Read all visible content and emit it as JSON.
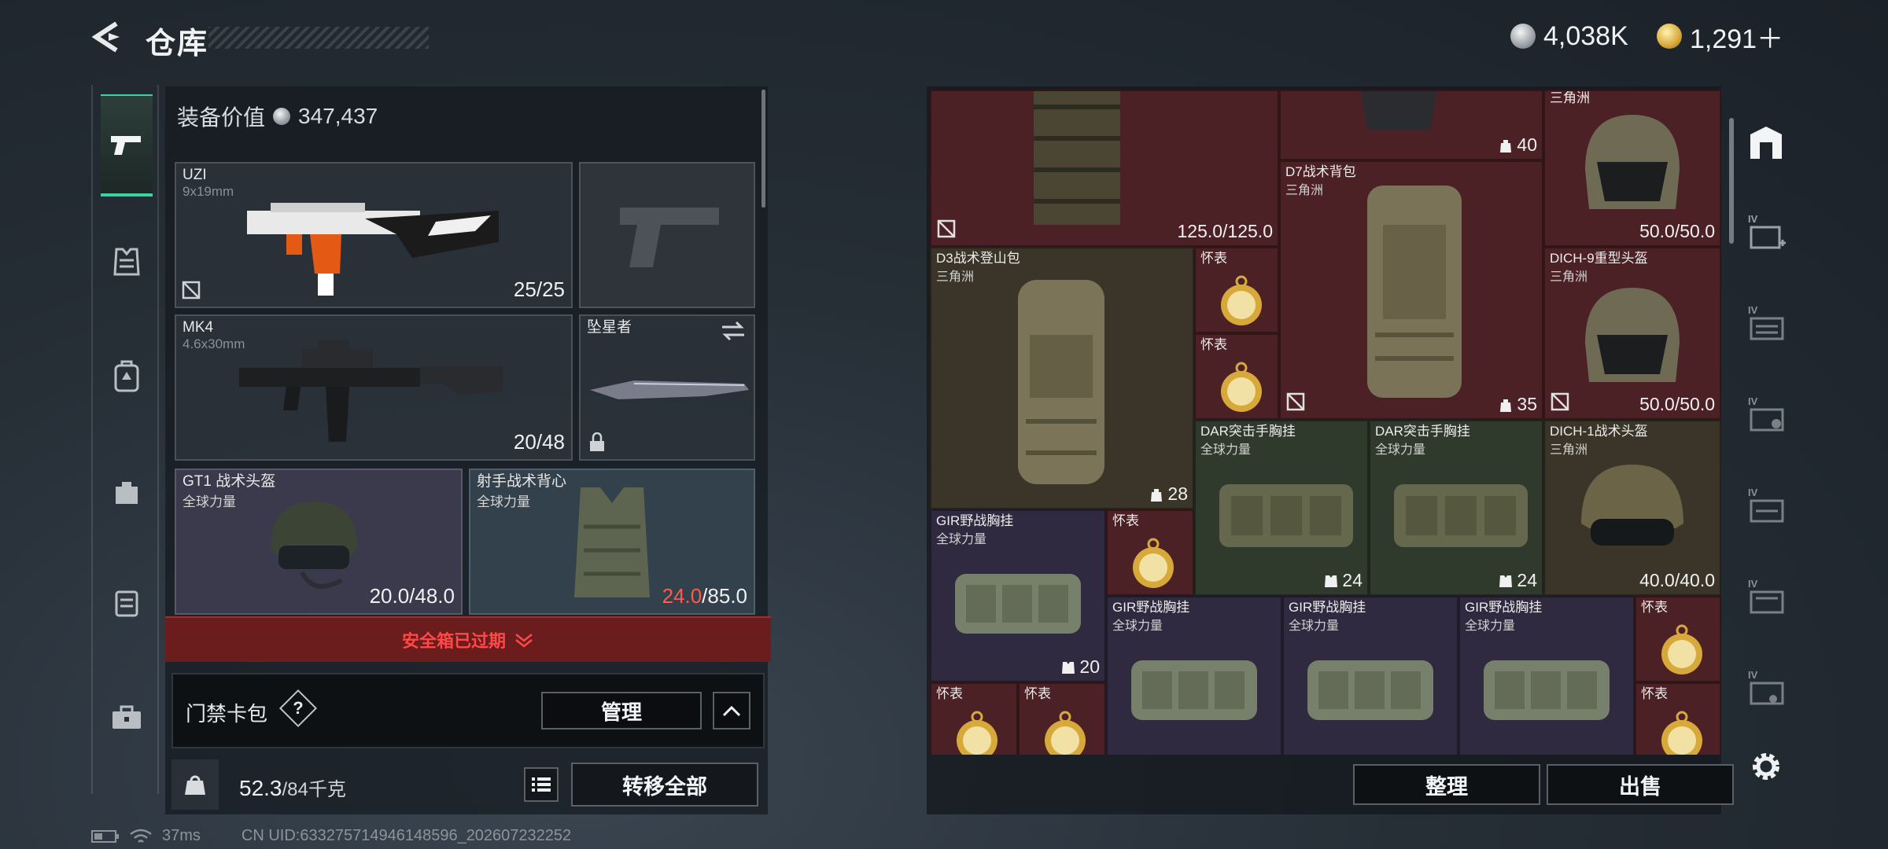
{
  "header": {
    "title": "仓库",
    "currencies": [
      {
        "name": "silver-coin",
        "amount": "4,038K"
      },
      {
        "name": "gold-coin",
        "amount": "1,291＋"
      }
    ]
  },
  "category_rail": [
    "weapon-icon",
    "vest-icon",
    "backpack-icon",
    "bag-icon",
    "case-icon",
    "toolbox-icon"
  ],
  "equipment": {
    "value_label": "装备价值",
    "value": "347,437",
    "slots": [
      {
        "name": "UZI",
        "sub": "9x19mm",
        "value": "25/25"
      },
      {
        "name": "",
        "sub": "",
        "value": ""
      },
      {
        "name": "MK4",
        "sub": "4.6x30mm",
        "value": "20/48"
      },
      {
        "name": "坠星者",
        "sub": "",
        "value": ""
      },
      {
        "name": "GT1 战术头盔",
        "sub": "全球力量",
        "value": "20.0/48.0"
      },
      {
        "name": "射手战术背心",
        "sub": "全球力量",
        "value_red": "24.0",
        "value_rest": "/85.0"
      }
    ],
    "safebox_status": "安全箱已过期",
    "keycard_label": "门禁卡包",
    "keycard_help": "?",
    "manage_label": "管理",
    "weight_value": "52.3",
    "weight_capacity": "/84千克",
    "transfer_all_label": "转移全部"
  },
  "status_bar": {
    "ping": "37ms",
    "uid": "CN UID:633275714946148596_202607232252"
  },
  "stash": {
    "items": [
      {
        "name": "",
        "sub": "",
        "value": "125.0/125.0"
      },
      {
        "name": "",
        "sub": "",
        "capacity": "40"
      },
      {
        "name": "",
        "sub": "三角洲",
        "value": "50.0/50.0"
      },
      {
        "name": "D7战术背包",
        "sub": "三角洲",
        "capacity": "35"
      },
      {
        "name": "D3战术登山包",
        "sub": "三角洲",
        "capacity": "28"
      },
      {
        "name": "怀表",
        "sub": ""
      },
      {
        "name": "怀表",
        "sub": ""
      },
      {
        "name": "DICH-9重型头盔",
        "sub": "三角洲",
        "value": "50.0/50.0"
      },
      {
        "name": "DAR突击手胸挂",
        "sub": "全球力量",
        "capacity": "24"
      },
      {
        "name": "DAR突击手胸挂",
        "sub": "全球力量",
        "capacity": "24"
      },
      {
        "name": "DICH-1战术头盔",
        "sub": "三角洲",
        "value": "40.0/40.0"
      },
      {
        "name": "GIR野战胸挂",
        "sub": "全球力量",
        "capacity": "20"
      },
      {
        "name": "怀表",
        "sub": ""
      },
      {
        "name": "GIR野战胸挂",
        "sub": "全球力量"
      },
      {
        "name": "GIR野战胸挂",
        "sub": "全球力量"
      },
      {
        "name": "GIR野战胸挂",
        "sub": "全球力量"
      },
      {
        "name": "怀表",
        "sub": ""
      },
      {
        "name": "怀表",
        "sub": ""
      },
      {
        "name": "怀表",
        "sub": ""
      },
      {
        "name": "怀表",
        "sub": ""
      }
    ],
    "sort_label": "整理",
    "sell_label": "出售"
  },
  "container_rail": {
    "tier_label": "IV",
    "items": [
      "safehouse-icon",
      "medical-container-icon",
      "container-icon",
      "container-icon",
      "container-icon",
      "container-icon",
      "container-icon"
    ]
  },
  "colors": {
    "accent": "#39d5a0",
    "warning_red": "#ff4848",
    "rare_red_cell": "#4c2125",
    "epic_purple_cell": "#2f2a3f"
  }
}
